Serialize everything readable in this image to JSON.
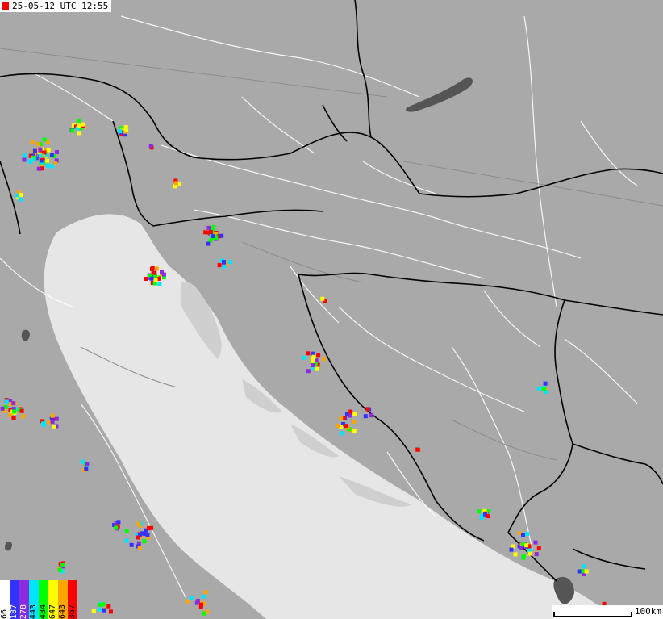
{
  "header": {
    "timestamp": "25-05-12 UTC 12:55"
  },
  "legend": {
    "bins": [
      {
        "label": "66",
        "color": "#ffffff"
      },
      {
        "label": "187",
        "color": "#3333ff"
      },
      {
        "label": "278",
        "color": "#8a2be2"
      },
      {
        "label": "443",
        "color": "#00e5ff"
      },
      {
        "label": "484",
        "color": "#00ff00"
      },
      {
        "label": "647",
        "color": "#ffff00"
      },
      {
        "label": "643",
        "color": "#ffa500"
      },
      {
        "label": "367",
        "color": "#ff0000"
      }
    ]
  },
  "scale": {
    "label": "100km"
  },
  "colors": {
    "land": "#a9a9a9",
    "sea": "#e6e6e6",
    "lake": "#555555",
    "border": "#000000",
    "river": "#ffffff"
  }
}
